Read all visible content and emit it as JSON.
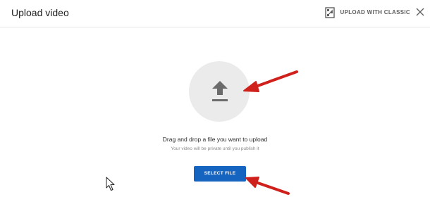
{
  "dialog": {
    "title": "Upload video",
    "classic_label": "UPLOAD WITH CLASSIC",
    "classic_icon": "film-icon",
    "close_icon": "close-icon"
  },
  "upload": {
    "icon": "upload-arrow-icon",
    "drag_text": "Drag and drop a file you want to upload",
    "private_text": "Your video will be private until you publish it",
    "select_label": "SELECT FILE"
  },
  "colors": {
    "accent": "#1565c0",
    "annotation": "#d0201b",
    "circle": "#ebebeb"
  }
}
